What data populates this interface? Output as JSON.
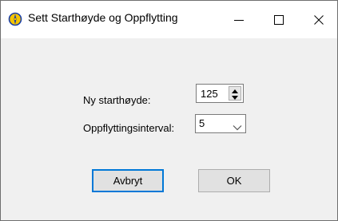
{
  "window": {
    "title": "Sett Starthøyde og Oppflytting",
    "icon": "compass-icon"
  },
  "titlebar_controls": {
    "minimize_icon": "minimize-icon",
    "maximize_icon": "maximize-icon",
    "close_icon": "close-icon"
  },
  "form": {
    "start_height_label": "Ny starthøyde:",
    "start_height_value": "125",
    "interval_label": "Oppflyttingsinterval:",
    "interval_value": "5"
  },
  "buttons": {
    "cancel_label": "Avbryt",
    "ok_label": "OK"
  },
  "colors": {
    "focus_border": "#0078d7",
    "dialog_background": "#f0f0f0"
  }
}
